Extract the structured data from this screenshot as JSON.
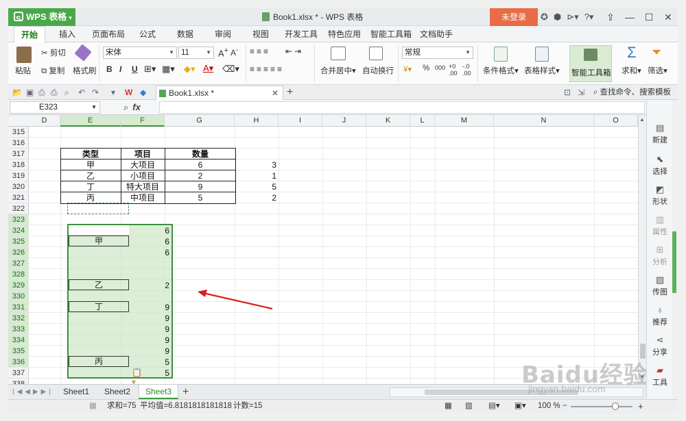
{
  "titlebar": {
    "app_label": "WPS 表格",
    "window_title": "Book1.xlsx * - WPS 表格",
    "login_label": "未登录"
  },
  "menu": {
    "tabs": [
      "开始",
      "插入",
      "页面布局",
      "公式",
      "数据",
      "审阅",
      "视图",
      "开发工具",
      "特色应用",
      "智能工具箱",
      "文档助手"
    ]
  },
  "ribbon": {
    "paste": "粘贴",
    "cut": "剪切",
    "copy": "复制",
    "format_painter": "格式刷",
    "font_name": "宋体",
    "font_size": "11",
    "merge_center": "合并居中",
    "wrap_text": "自动换行",
    "number_format": "常规",
    "conditional_format": "条件格式",
    "table_style": "表格样式",
    "smart_toolbox": "智能工具箱",
    "sum": "求和",
    "filter": "筛选",
    "bold": "B",
    "italic": "I",
    "underline": "U",
    "percent": "%",
    "thousands": "000"
  },
  "docbar": {
    "doc_tab": "Book1.xlsx *",
    "search_placeholder": "查找命令、搜索模板"
  },
  "formula": {
    "name_box": "E323",
    "fx": "fx",
    "value": ""
  },
  "grid": {
    "columns": [
      "D",
      "E",
      "F",
      "G",
      "H",
      "I",
      "J",
      "K",
      "L",
      "M",
      "N",
      "O"
    ],
    "rows": [
      "315",
      "316",
      "317",
      "318",
      "319",
      "320",
      "321",
      "322",
      "323",
      "324",
      "325",
      "326",
      "327",
      "328",
      "329",
      "330",
      "331",
      "332",
      "333",
      "334",
      "335",
      "336",
      "337",
      "338"
    ],
    "table_headers": [
      "类型",
      "项目",
      "数量"
    ],
    "table_rows": [
      [
        "甲",
        "大项目",
        "6"
      ],
      [
        "乙",
        "小项目",
        "2"
      ],
      [
        "丁",
        "特大项目",
        "9"
      ],
      [
        "丙",
        "中项目",
        "5"
      ]
    ],
    "h_values": [
      "3",
      "1",
      "5",
      "2"
    ],
    "f_values": [
      "6",
      "6",
      "6",
      "",
      "",
      "2",
      "",
      "9",
      "9",
      "9",
      "9",
      "9",
      "5",
      "5"
    ],
    "e_labels": [
      {
        "row": "324",
        "text": "甲"
      },
      {
        "row": "328",
        "text": "乙"
      },
      {
        "row": "330",
        "text": "丁"
      },
      {
        "row": "335",
        "text": "丙"
      }
    ]
  },
  "sidebar": {
    "items": [
      "新建",
      "选择",
      "形状",
      "属性",
      "分析",
      "传图",
      "推荐",
      "分享",
      "工具"
    ]
  },
  "sheets": {
    "tabs": [
      "Sheet1",
      "Sheet2",
      "Sheet3"
    ],
    "active": "Sheet3"
  },
  "status": {
    "sum": "求和=75",
    "average": "平均值=6.8181818181818",
    "count": "计数=15",
    "zoom": "100 %"
  },
  "watermark": {
    "text": "Baidu经验",
    "url": "jingyan.baidu.com"
  },
  "colors": {
    "accent_green": "#4aa84a",
    "login_orange": "#e86c45",
    "arrow_red": "#d62020"
  }
}
